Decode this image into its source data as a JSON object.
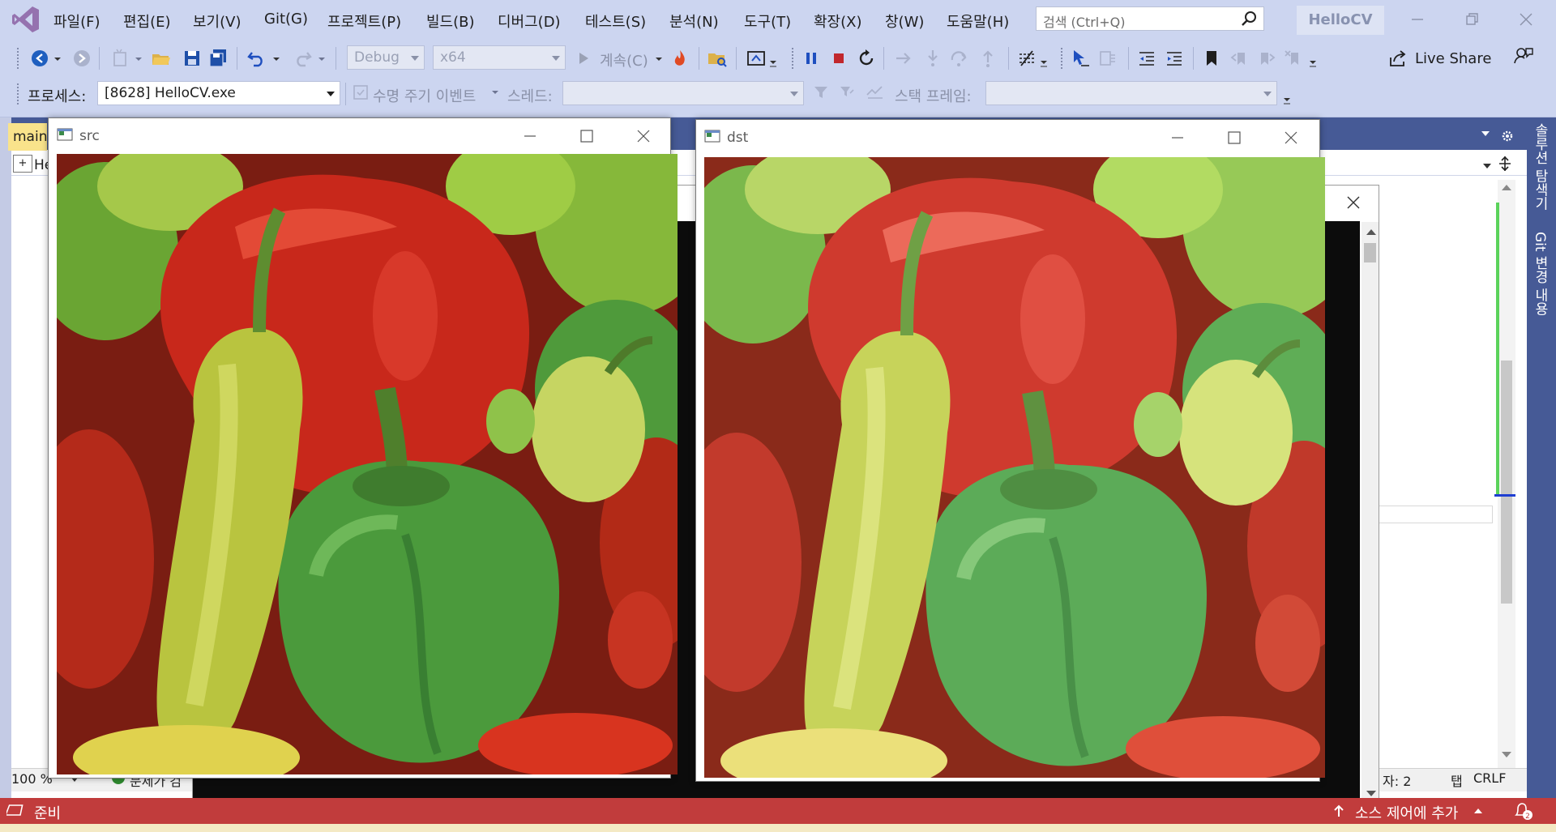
{
  "menu": {
    "items": [
      "파일(F)",
      "편집(E)",
      "보기(V)",
      "Git(G)",
      "프로젝트(P)",
      "빌드(B)",
      "디버그(D)",
      "테스트(S)",
      "분석(N)",
      "도구(T)",
      "확장(X)",
      "창(W)",
      "도움말(H)"
    ],
    "search_placeholder": "검색 (Ctrl+Q)",
    "app_title": "HelloCV"
  },
  "toolbar": {
    "config": "Debug",
    "platform": "x64",
    "continue_label": "계속(C)",
    "live_share": "Live Share"
  },
  "debug_location": {
    "process_label": "프로세스:",
    "process_value": "[8628] HelloCV.exe",
    "lifecycle_events": "수명 주기 이벤트",
    "thread_label": "스레드:",
    "stack_frame_label": "스택 프레임:"
  },
  "editor": {
    "doc_tab": "main",
    "nav_label": "He",
    "zoom": "100 %",
    "issues": "문제가 검",
    "tab_size": "자: 2",
    "indent_mode": "탭",
    "line_ending": "CRLF"
  },
  "side_tabs": [
    "솔루션 탐색기",
    "Git 변경 내용"
  ],
  "windows": {
    "src_title": "src",
    "dst_title": "dst"
  },
  "statusbar": {
    "ready": "준비",
    "source_control": "소스 제어에 추가",
    "notifications": "2"
  },
  "colors": {
    "accent": "#465a96",
    "statusbar": "#c13c3c",
    "chrome": "#ccd5f0"
  }
}
